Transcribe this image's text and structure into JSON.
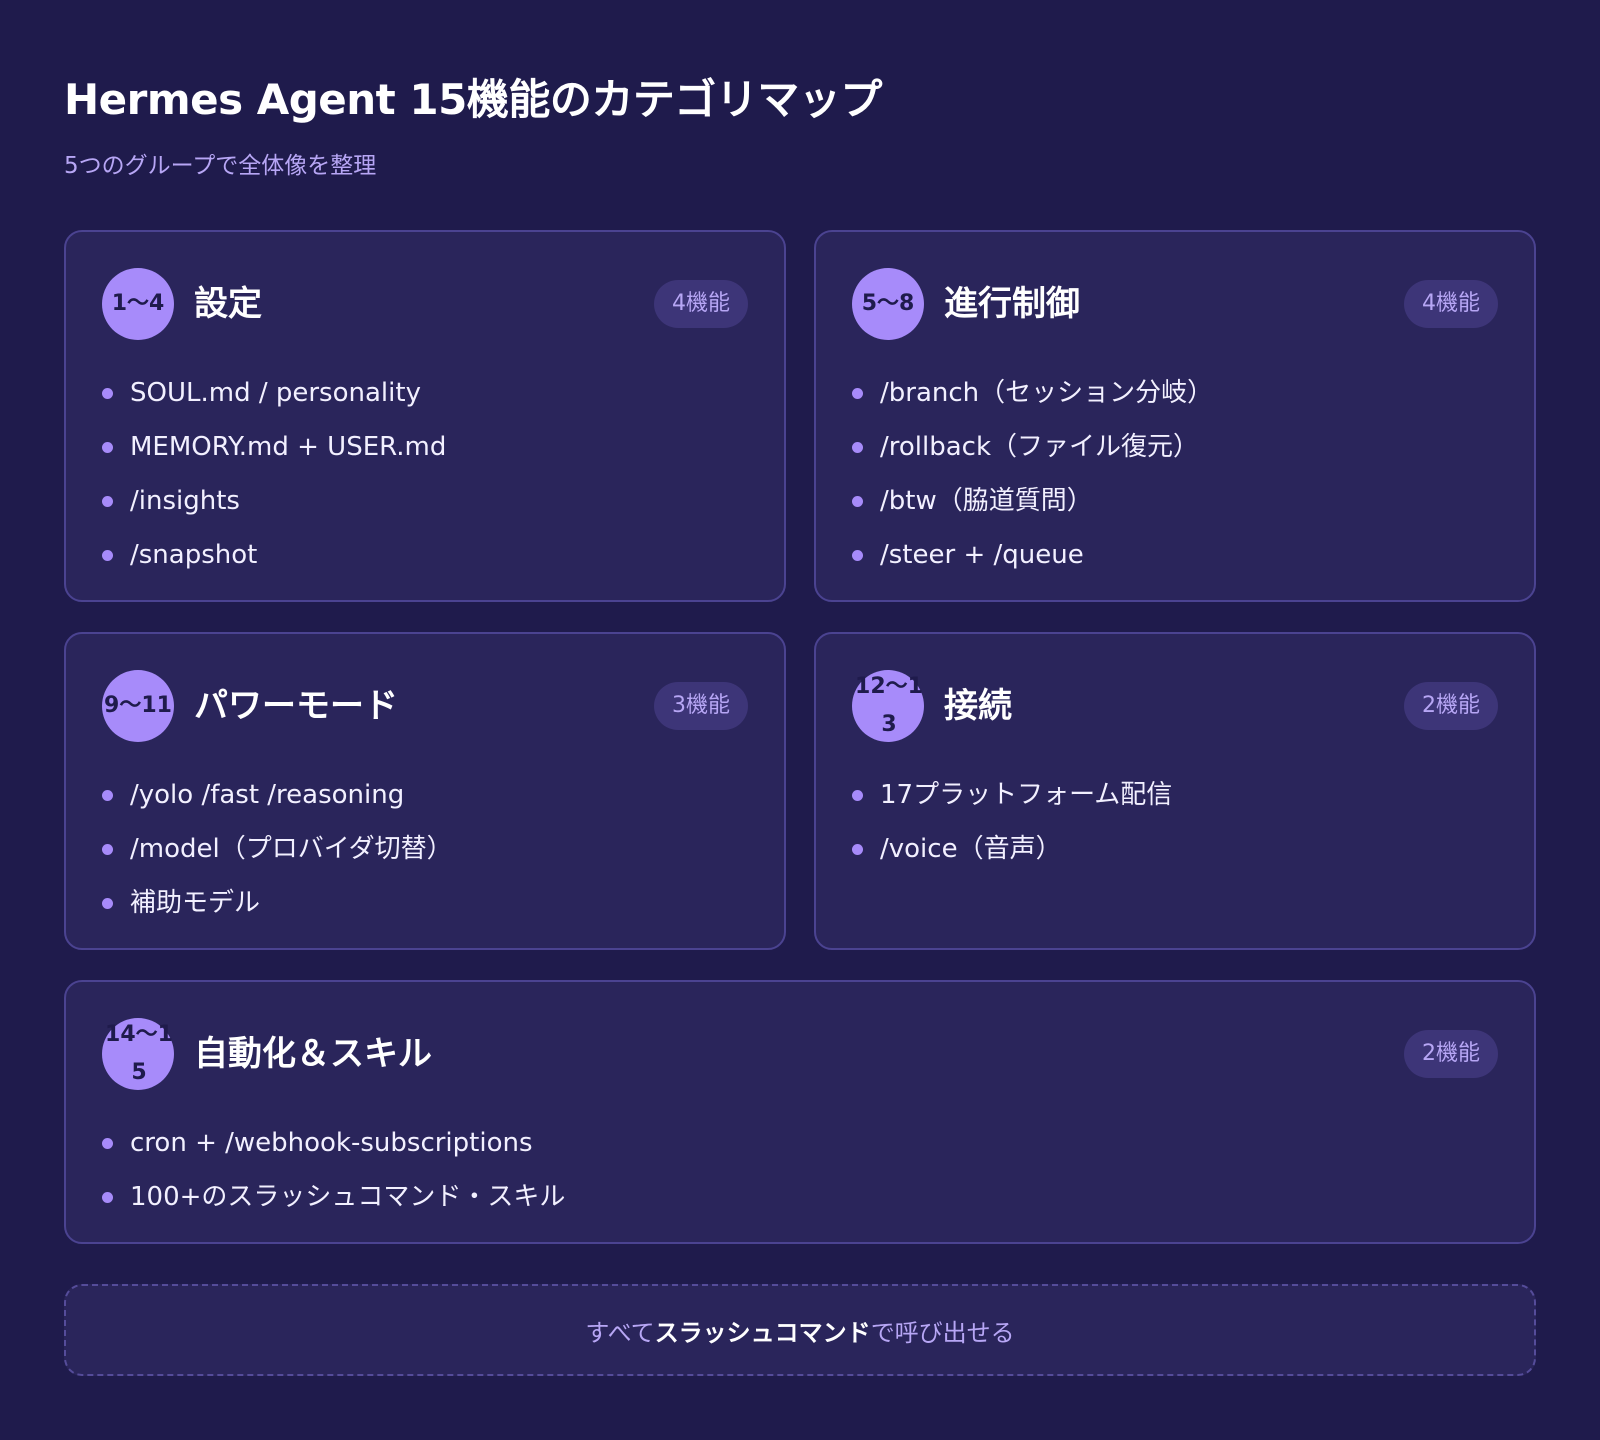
{
  "title": "Hermes Agent 15機能のカテゴリマップ",
  "subtitle": "5つのグループで全体像を整理",
  "groups": [
    {
      "range": "1〜4",
      "title": "設定",
      "count": "4機能",
      "items": [
        "SOUL.md / personality",
        "MEMORY.md + USER.md",
        "/insights",
        "/snapshot"
      ]
    },
    {
      "range": "5〜8",
      "title": "進行制御",
      "count": "4機能",
      "items": [
        "/branch（セッション分岐）",
        "/rollback（ファイル復元）",
        "/btw（脇道質問）",
        "/steer + /queue"
      ]
    },
    {
      "range": "9〜11",
      "title": "パワーモード",
      "count": "3機能",
      "items": [
        "/yolo /fast /reasoning",
        "/model（プロバイダ切替）",
        "補助モデル"
      ]
    },
    {
      "range": "12〜13",
      "title": "接続",
      "count": "2機能",
      "items": [
        "17プラットフォーム配信",
        "/voice（音声）"
      ]
    },
    {
      "range": "14〜15",
      "title": "自動化＆スキル",
      "count": "2機能",
      "items": [
        "cron + /webhook-subscriptions",
        "100+のスラッシュコマンド・スキル"
      ]
    }
  ],
  "footer": {
    "prefix": "すべて",
    "emphasis": "スラッシュコマンド",
    "suffix": "で呼び出せる"
  },
  "colors": {
    "background": "#1f1b4c",
    "card": "#2a255b",
    "card_border": "#4b4391",
    "accent": "#a78bfa",
    "muted_text": "#b7a6f5"
  }
}
